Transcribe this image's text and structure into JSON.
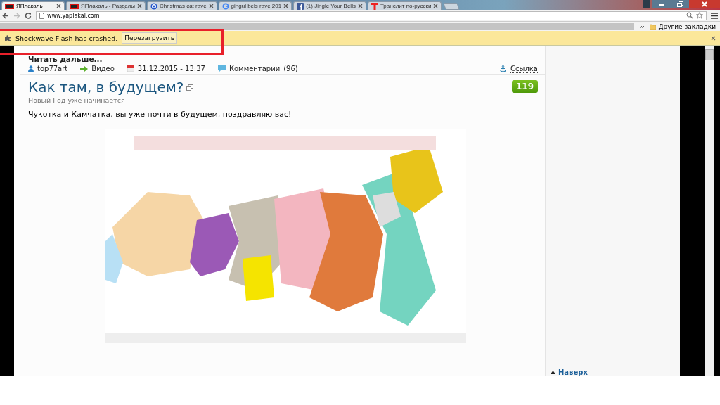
{
  "tabs": [
    {
      "label": "ЯПлакаль",
      "selected": true
    },
    {
      "label": "ЯПлакаль - Разделы",
      "selected": false
    },
    {
      "label": "Christmas cat rave",
      "selected": false
    },
    {
      "label": "gingul bels rave 201",
      "selected": false
    },
    {
      "label": "(1) Jingle Your Bells",
      "selected": false
    },
    {
      "label": "Транслит по-русски",
      "selected": false
    }
  ],
  "address": {
    "url": "www.yaplakal.com"
  },
  "bookmarks": {
    "folder": "Другие закладки"
  },
  "infobar": {
    "message": "Shockwave Flash has crashed.",
    "button": "Перезагрузить"
  },
  "post_prev": {
    "read_more": "Читать дальше..."
  },
  "meta": {
    "author": "top77art",
    "section": "Видео",
    "date": "31.12.2015 - 13:37",
    "comments_link": "Комментарии",
    "comments_count": "(96)",
    "permalink": "Ссылка"
  },
  "post": {
    "title": "Как там, в будущем?",
    "subtitle": "Новый Год уже начинается",
    "rating": "119",
    "text": "Чукотка и Камчатка, вы уже почти в будущем, поздравляю вас!"
  },
  "sidebar": {
    "to_top": "Наверх"
  }
}
